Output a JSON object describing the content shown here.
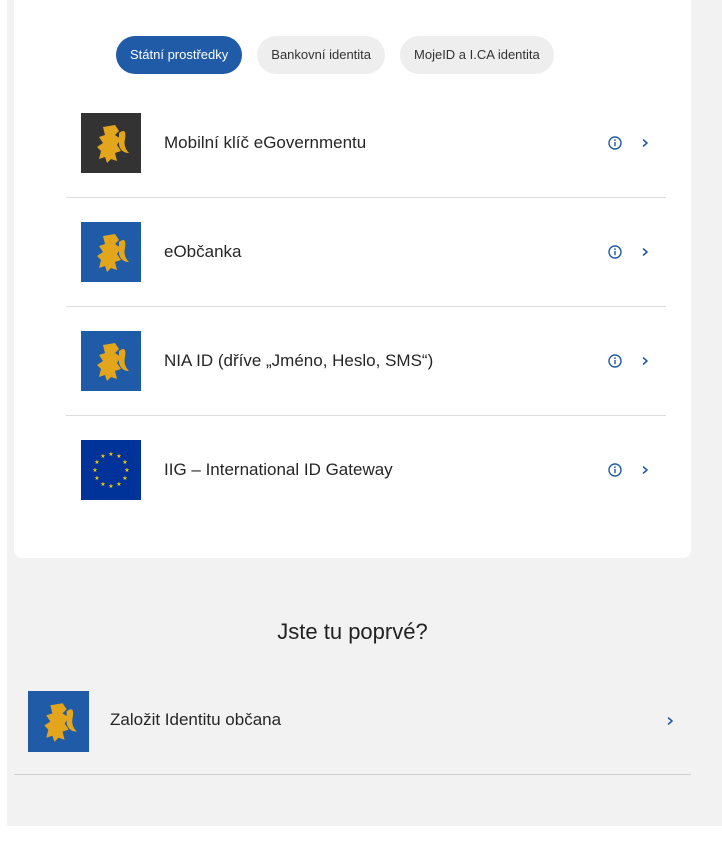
{
  "tabs": [
    {
      "label": "Státní prostředky",
      "active": true
    },
    {
      "label": "Bankovní identita",
      "active": false
    },
    {
      "label": "MojeID a I.CA identita",
      "active": false
    }
  ],
  "methods": [
    {
      "label": "Mobilní klíč eGovernmentu",
      "logo": "czech-lion-dark"
    },
    {
      "label": "eObčanka",
      "logo": "czech-lion-blue"
    },
    {
      "label": "NIA ID (dříve „Jméno, Heslo, SMS“)",
      "logo": "czech-lion-blue"
    },
    {
      "label": "IIG – International ID Gateway",
      "logo": "eu-flag"
    }
  ],
  "first_time": {
    "title": "Jste tu poprvé?",
    "item_label": "Založit Identitu občana"
  },
  "colors": {
    "accent": "#1f5ba6",
    "lion": "#e3a51c",
    "dark_logo": "#333333",
    "eu_blue": "#003399",
    "eu_star": "#ffcc00"
  }
}
